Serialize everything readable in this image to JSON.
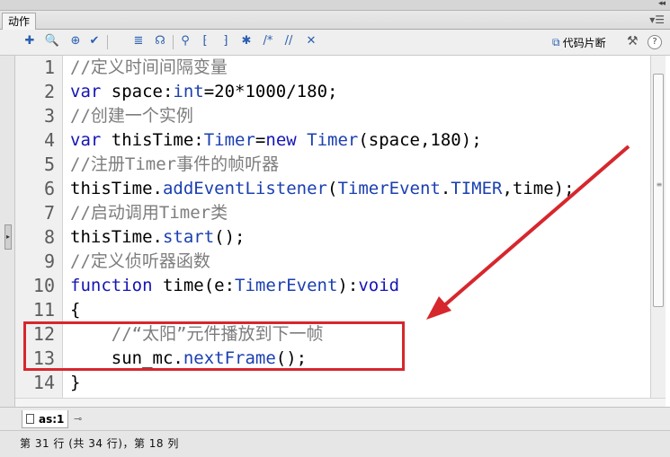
{
  "panel": {
    "tab_label": "动作",
    "collapse_glyph": "◂◂",
    "menu_glyph": "▾☰"
  },
  "toolbar": {
    "snippets_label": "代码片断",
    "help_label": "?",
    "buttons": [
      {
        "icon": "add-statement-icon",
        "glyph": "✚"
      },
      {
        "icon": "find-icon",
        "glyph": "🔍"
      },
      {
        "icon": "target-path-icon",
        "glyph": "⊕"
      },
      {
        "icon": "check-syntax-icon",
        "glyph": "✔"
      },
      {
        "icon": "format-code-icon",
        "glyph": "≣"
      },
      {
        "icon": "code-hint-icon",
        "glyph": "☊"
      },
      {
        "icon": "debug-options-icon",
        "glyph": "⚲"
      },
      {
        "icon": "collapse-between-braces-icon",
        "glyph": "⁅"
      },
      {
        "icon": "collapse-selection-icon",
        "glyph": "⁆"
      },
      {
        "icon": "expand-all-icon",
        "glyph": "✱"
      },
      {
        "icon": "apply-block-comment-icon",
        "glyph": "/*"
      },
      {
        "icon": "apply-line-comment-icon",
        "glyph": "//"
      },
      {
        "icon": "remove-comment-icon",
        "glyph": "✕"
      },
      {
        "icon": "show-hide-toolbox-icon",
        "glyph": "⊞"
      }
    ]
  },
  "editor": {
    "line_numbers": [
      "1",
      "2",
      "3",
      "4",
      "5",
      "6",
      "7",
      "8",
      "9",
      "10",
      "11",
      "12",
      "13",
      "14"
    ],
    "lines": [
      [
        {
          "t": "//定义时间间隔变量",
          "c": "cm"
        }
      ],
      [
        {
          "t": "var",
          "c": "kw"
        },
        {
          "t": " space:",
          "c": ""
        },
        {
          "t": "int",
          "c": "ty"
        },
        {
          "t": "=20*1000/180;",
          "c": ""
        }
      ],
      [
        {
          "t": "//创建一个实例",
          "c": "cm"
        }
      ],
      [
        {
          "t": "var",
          "c": "kw"
        },
        {
          "t": " thisTime:",
          "c": ""
        },
        {
          "t": "Timer",
          "c": "ty"
        },
        {
          "t": "=",
          "c": ""
        },
        {
          "t": "new",
          "c": "kw"
        },
        {
          "t": " ",
          "c": ""
        },
        {
          "t": "Timer",
          "c": "ty"
        },
        {
          "t": "(space,180);",
          "c": ""
        }
      ],
      [
        {
          "t": "//注册Timer事件的帧听器",
          "c": "cm"
        }
      ],
      [
        {
          "t": "thisTime.",
          "c": ""
        },
        {
          "t": "addEventListener",
          "c": "fn"
        },
        {
          "t": "(",
          "c": ""
        },
        {
          "t": "TimerEvent",
          "c": "ty"
        },
        {
          "t": ".",
          "c": ""
        },
        {
          "t": "TIMER",
          "c": "ty"
        },
        {
          "t": ",time);",
          "c": ""
        }
      ],
      [
        {
          "t": "//启动调用Timer类",
          "c": "cm"
        }
      ],
      [
        {
          "t": "thisTime.",
          "c": ""
        },
        {
          "t": "start",
          "c": "fn"
        },
        {
          "t": "();",
          "c": ""
        }
      ],
      [
        {
          "t": "//定义侦听器函数",
          "c": "cm"
        }
      ],
      [
        {
          "t": "function",
          "c": "kw"
        },
        {
          "t": " time(e:",
          "c": ""
        },
        {
          "t": "TimerEvent",
          "c": "ty"
        },
        {
          "t": "):",
          "c": ""
        },
        {
          "t": "void",
          "c": "kw"
        }
      ],
      [
        {
          "t": "{",
          "c": ""
        }
      ],
      [
        {
          "t": "    //“太阳”元件播放到下一帧",
          "c": "cm"
        }
      ],
      [
        {
          "t": "    sun_mc.",
          "c": ""
        },
        {
          "t": "nextFrame",
          "c": "fn"
        },
        {
          "t": "();",
          "c": ""
        }
      ],
      [
        {
          "t": "}",
          "c": ""
        }
      ]
    ]
  },
  "script_tab": {
    "label": "as:1",
    "pin_glyph": "⊸"
  },
  "status": {
    "text": "第 31 行 (共 34 行)，第 18 列"
  },
  "colors": {
    "keyword": "#1515b5",
    "type": "#1a3fb0",
    "comment": "#7d7d7d",
    "annotation": "#d6272d"
  }
}
